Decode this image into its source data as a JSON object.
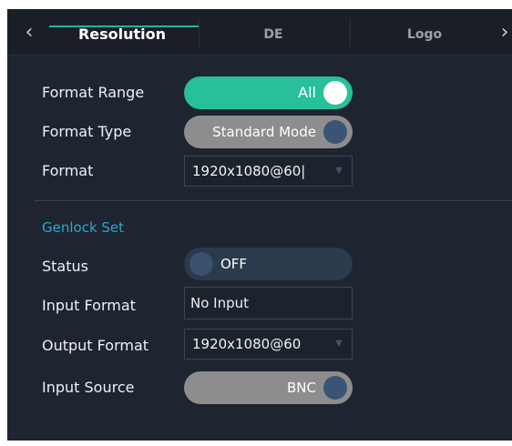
{
  "tabs": {
    "items": [
      {
        "label": "Resolution",
        "active": true
      },
      {
        "label": "DE",
        "active": false
      },
      {
        "label": "Logo",
        "active": false
      }
    ],
    "prev_icon": "chevron-left-icon",
    "next_icon": "chevron-right-icon"
  },
  "resolution": {
    "format_range": {
      "label": "Format Range",
      "value": "All",
      "on": true
    },
    "format_type": {
      "label": "Format Type",
      "value": "Standard Mode"
    },
    "format": {
      "label": "Format",
      "value": "1920x1080@60|"
    }
  },
  "genlock": {
    "section_title": "Genlock Set",
    "status": {
      "label": "Status",
      "value": "OFF",
      "on": false
    },
    "input_format": {
      "label": "Input Format",
      "value": "No Input"
    },
    "output_format": {
      "label": "Output Format",
      "value": "1920x1080@60"
    },
    "input_source": {
      "label": "Input Source",
      "value": "BNC"
    }
  },
  "colors": {
    "accent_teal": "#27c09b",
    "section_blue": "#25a8d4",
    "panel_bg": "#1e2530"
  }
}
